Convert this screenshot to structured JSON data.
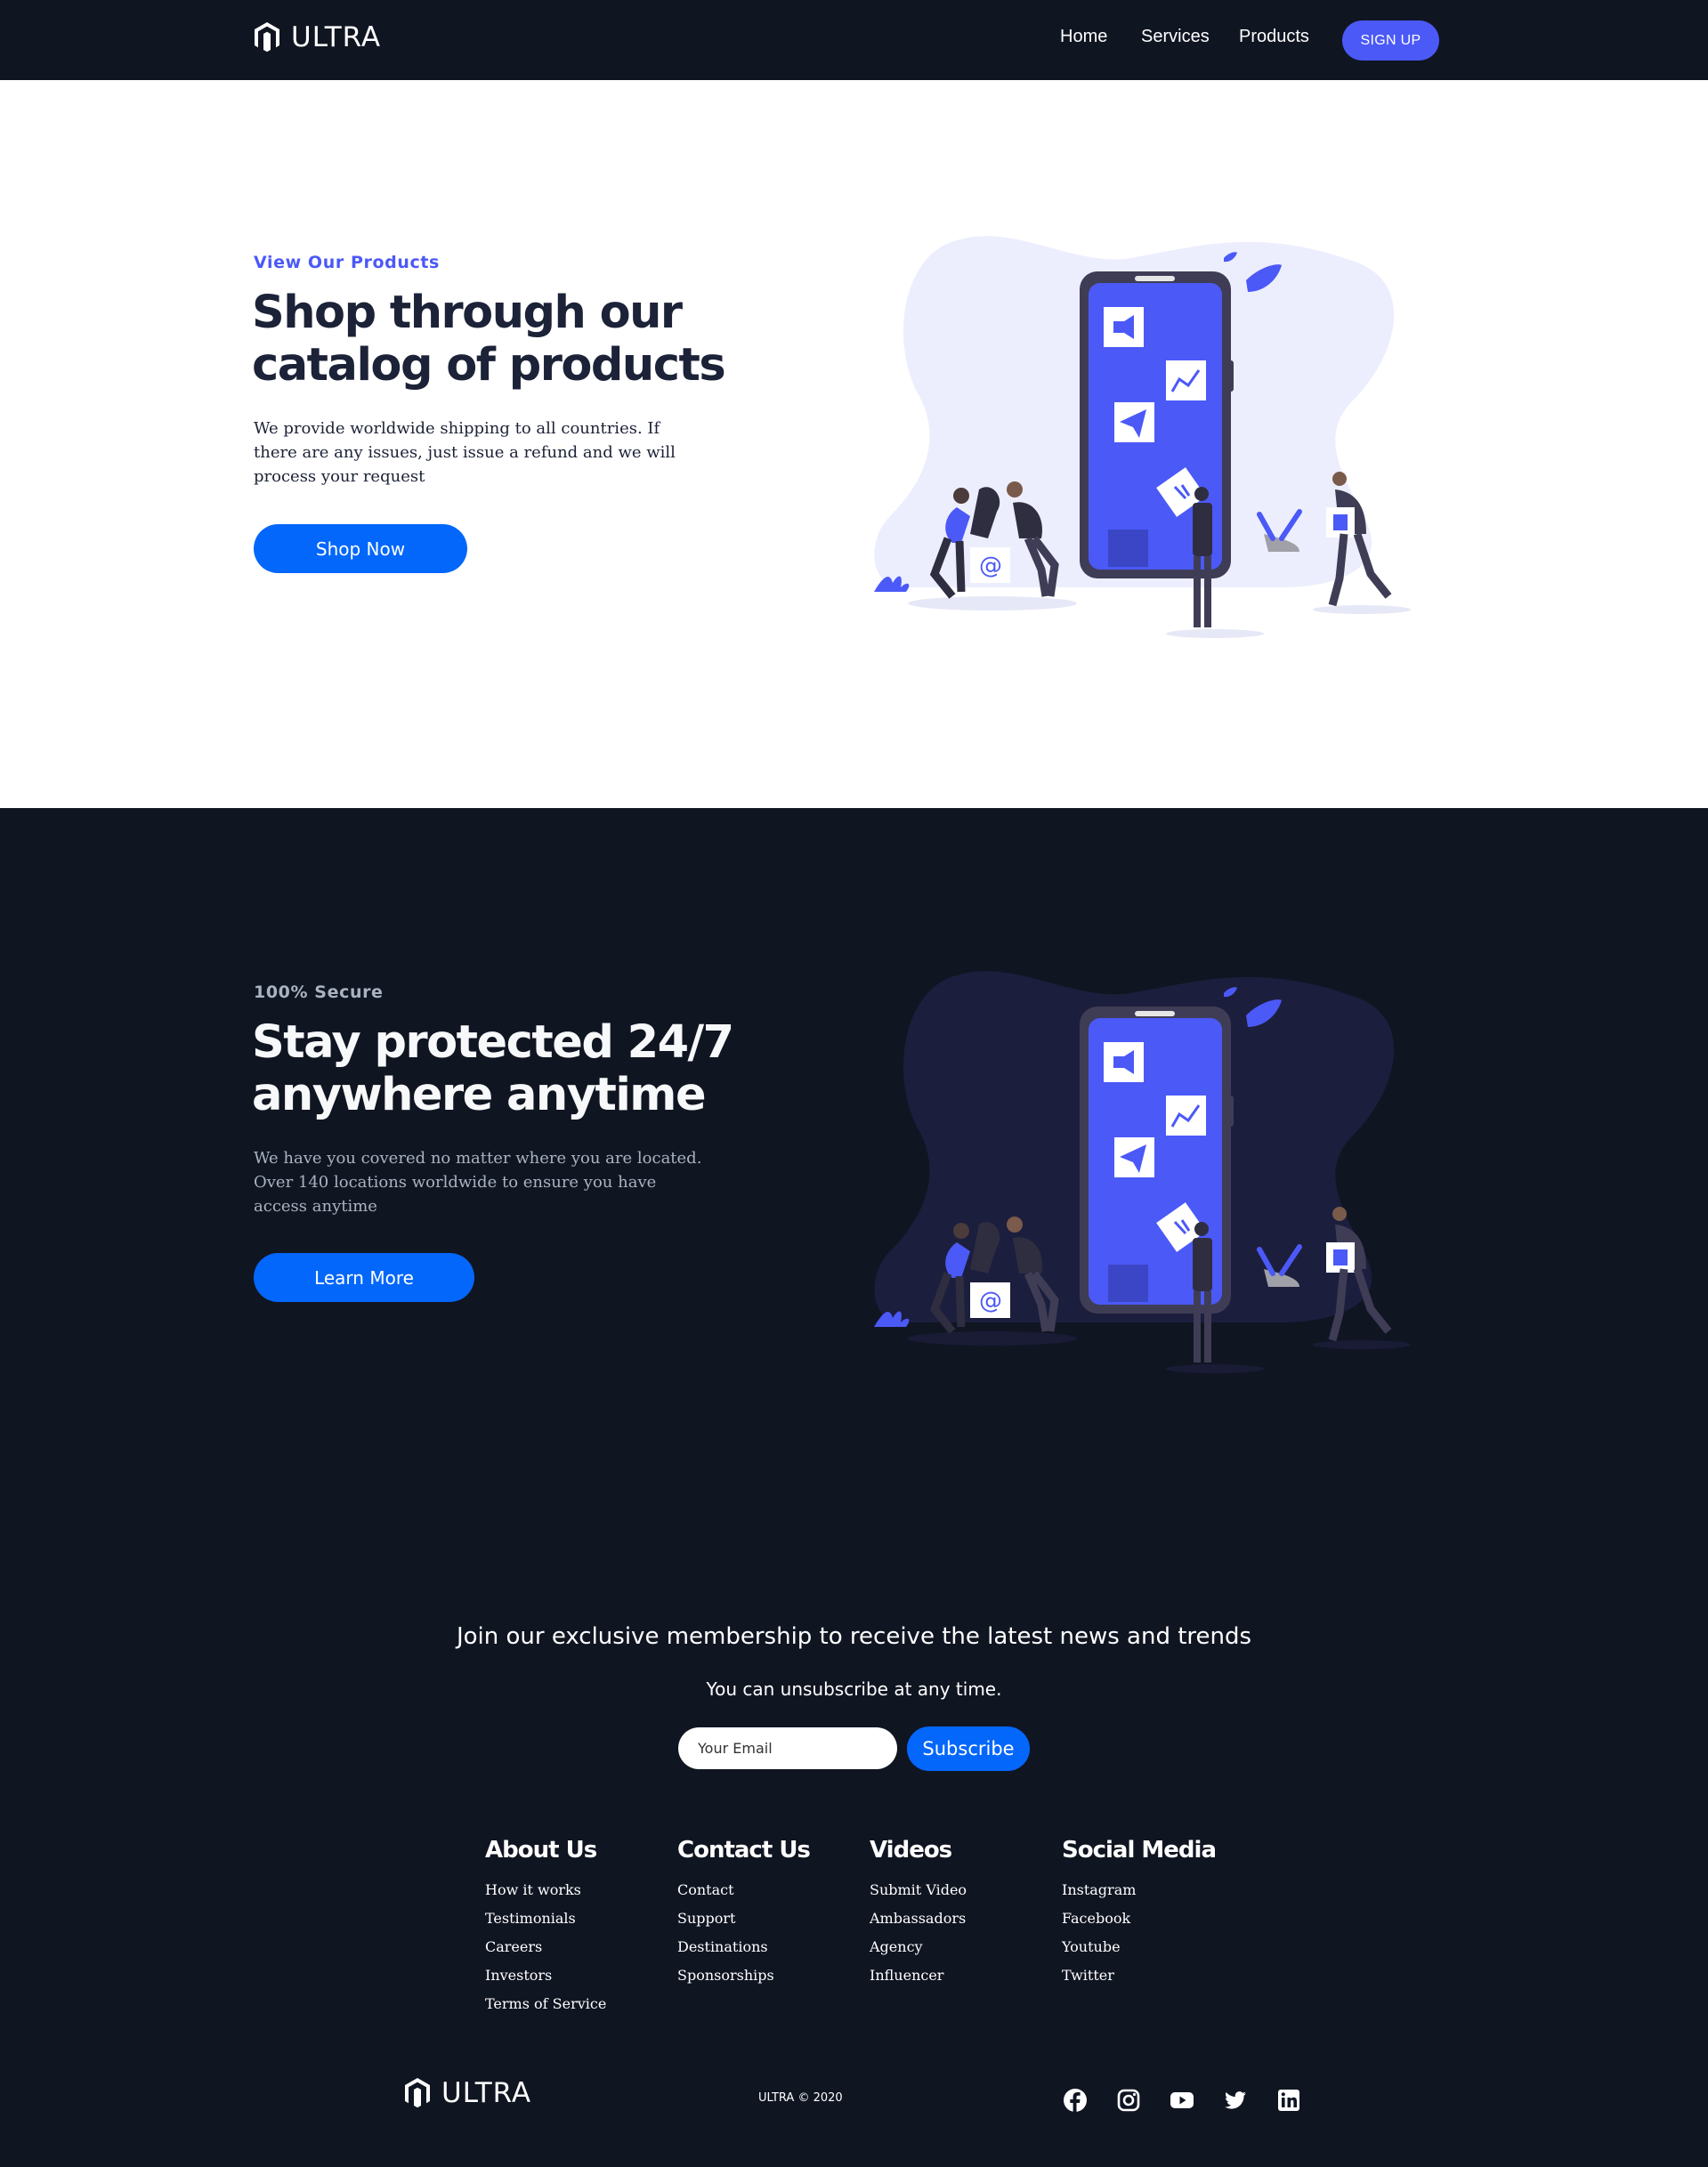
{
  "brand": {
    "name": "ULTRA",
    "logo_icon": "magento-logo-icon"
  },
  "nav": {
    "links": [
      "Home",
      "Services",
      "Products"
    ],
    "signup_label": "SIGN UP"
  },
  "hero_products": {
    "top_line": "View Our Products",
    "heading": "Shop through our catalog of products",
    "description": "We provide worldwide shipping to all countries. If there are any issues, just issue a refund and we will process your request",
    "button_label": "Shop Now"
  },
  "hero_secure": {
    "top_line": "100% Secure",
    "heading": "Stay protected 24/7 anywhere anytime",
    "description": "We have you covered no matter where you are located. Over 140 locations worldwide to ensure you have access anytime",
    "button_label": "Learn More"
  },
  "subscription": {
    "heading": "Join our exclusive membership to receive the latest news and trends",
    "text": "You can unsubscribe at any time.",
    "email_placeholder": "Your Email",
    "button_label": "Subscribe"
  },
  "footer_columns": [
    {
      "title": "About Us",
      "links": [
        "How it works",
        "Testimonials",
        "Careers",
        "Investors",
        "Terms of Service"
      ]
    },
    {
      "title": "Contact Us",
      "links": [
        "Contact",
        "Support",
        "Destinations",
        "Sponsorships"
      ]
    },
    {
      "title": "Videos",
      "links": [
        "Submit Video",
        "Ambassadors",
        "Agency",
        "Influencer"
      ]
    },
    {
      "title": "Social Media",
      "links": [
        "Instagram",
        "Facebook",
        "Youtube",
        "Twitter"
      ]
    }
  ],
  "copyright": "ULTRA © 2020",
  "social_icons": [
    "facebook-icon",
    "instagram-icon",
    "youtube-icon",
    "twitter-icon",
    "linkedin-icon"
  ],
  "colors": {
    "dark_bg": "#101522",
    "accent": "#4b59f7",
    "button_blue": "#0467fb",
    "heading_dark": "#1c2237",
    "muted": "#a9b3c1"
  }
}
